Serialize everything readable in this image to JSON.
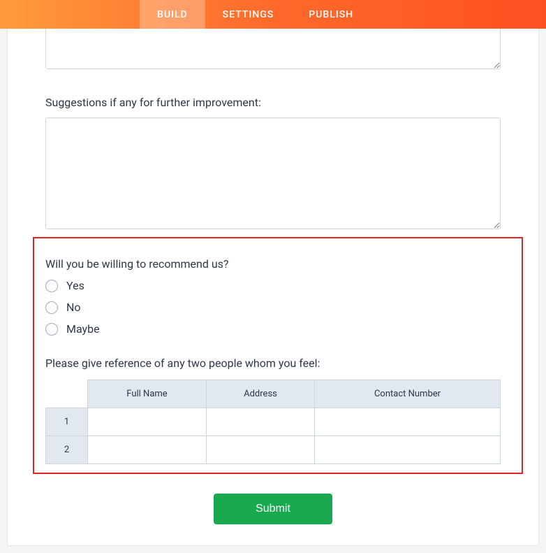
{
  "nav": {
    "tabs": [
      {
        "label": "BUILD",
        "active": true
      },
      {
        "label": "SETTINGS",
        "active": false
      },
      {
        "label": "PUBLISH",
        "active": false
      }
    ]
  },
  "form": {
    "suggestions_label": "Suggestions if any for further improvement:",
    "recommend_label": "Will you be willing to recommend us?",
    "recommend_options": [
      "Yes",
      "No",
      "Maybe"
    ],
    "reference_label": "Please give reference of any two people whom you feel:",
    "reference_table": {
      "columns": [
        "Full Name",
        "Address",
        "Contact Number"
      ],
      "rows": [
        "1",
        "2"
      ]
    },
    "submit_label": "Submit"
  }
}
